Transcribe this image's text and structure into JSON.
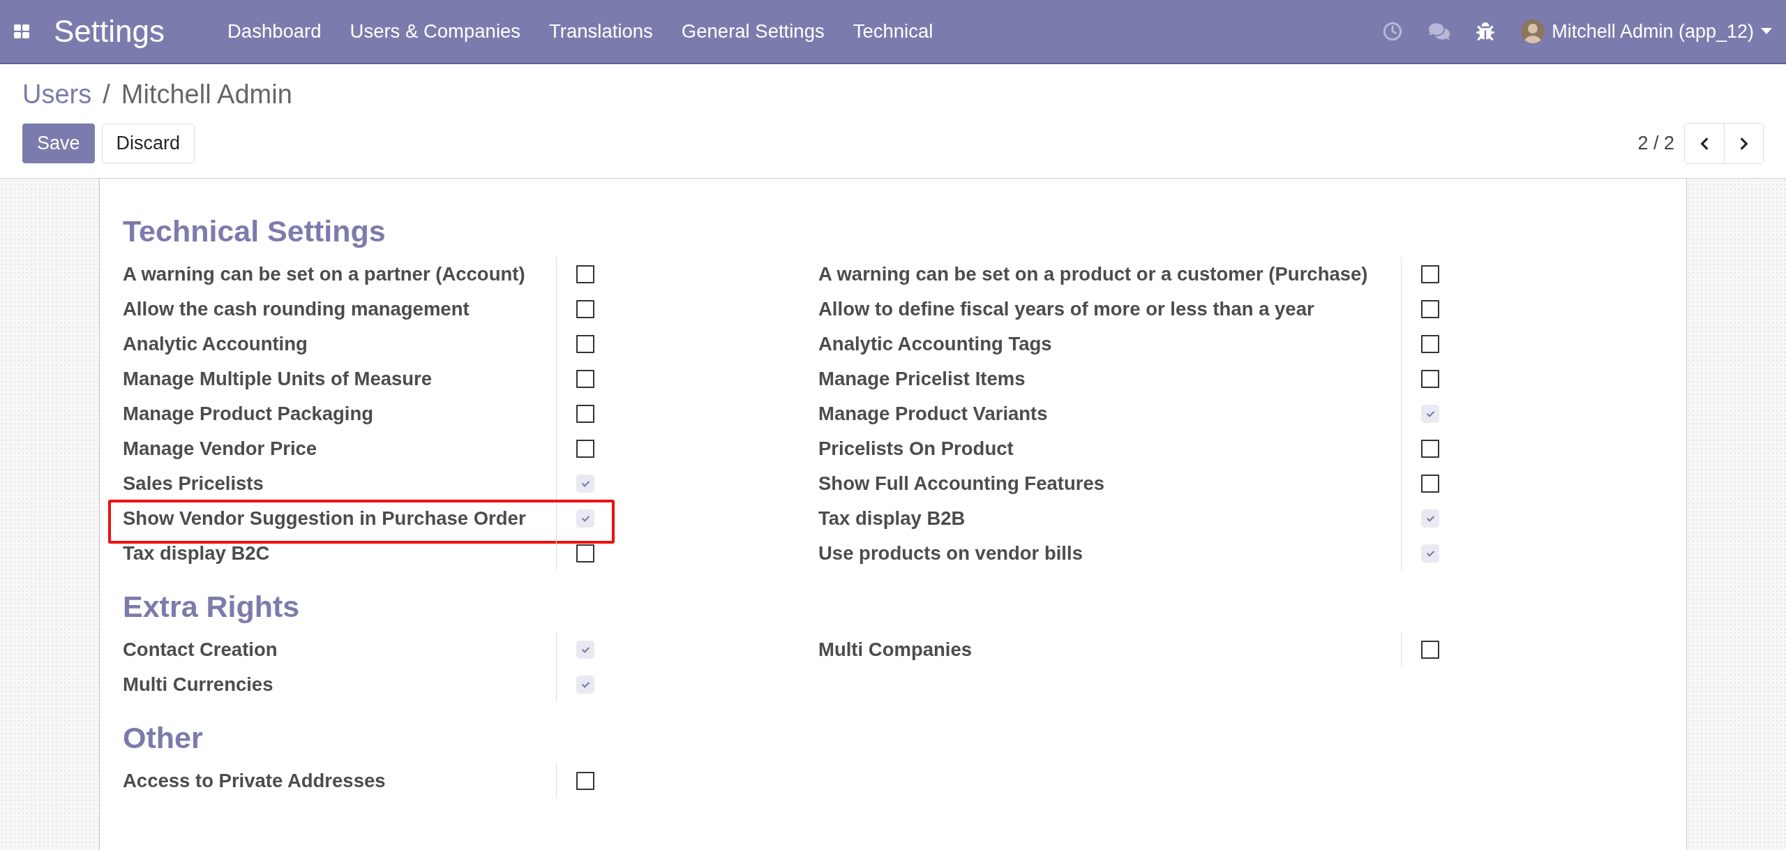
{
  "navbar": {
    "app_title": "Settings",
    "menu": [
      "Dashboard",
      "Users & Companies",
      "Translations",
      "General Settings",
      "Technical"
    ],
    "user": "Mitchell Admin (app_12)"
  },
  "breadcrumb": {
    "parent": "Users",
    "separator": "/",
    "current": "Mitchell Admin"
  },
  "buttons": [
    {
      "label": "Save",
      "kind": "primary"
    },
    {
      "label": "Discard",
      "kind": "secondary"
    }
  ],
  "pager": "2 / 2",
  "sections": [
    {
      "title": "Technical Settings",
      "columns": [
        [
          {
            "label": "A warning can be set on a partner (Account)",
            "checked": false,
            "highlighted": false
          },
          {
            "label": "Allow the cash rounding management",
            "checked": false,
            "highlighted": false
          },
          {
            "label": "Analytic Accounting",
            "checked": false,
            "highlighted": false
          },
          {
            "label": "Manage Multiple Units of Measure",
            "checked": false,
            "highlighted": false
          },
          {
            "label": "Manage Product Packaging",
            "checked": false,
            "highlighted": false
          },
          {
            "label": "Manage Vendor Price",
            "checked": false,
            "highlighted": false
          },
          {
            "label": "Sales Pricelists",
            "checked": true,
            "highlighted": false
          },
          {
            "label": "Show Vendor Suggestion in Purchase Order",
            "checked": true,
            "highlighted": true
          },
          {
            "label": "Tax display B2C",
            "checked": false,
            "highlighted": false
          }
        ],
        [
          {
            "label": "A warning can be set on a product or a customer (Purchase)",
            "checked": false,
            "highlighted": false
          },
          {
            "label": "Allow to define fiscal years of more or less than a year",
            "checked": false,
            "highlighted": false
          },
          {
            "label": "Analytic Accounting Tags",
            "checked": false,
            "highlighted": false
          },
          {
            "label": "Manage Pricelist Items",
            "checked": false,
            "highlighted": false
          },
          {
            "label": "Manage Product Variants",
            "checked": true,
            "highlighted": false
          },
          {
            "label": "Pricelists On Product",
            "checked": false,
            "highlighted": false
          },
          {
            "label": "Show Full Accounting Features",
            "checked": false,
            "highlighted": false
          },
          {
            "label": "Tax display B2B",
            "checked": true,
            "highlighted": false
          },
          {
            "label": "Use products on vendor bills",
            "checked": true,
            "highlighted": false
          }
        ]
      ]
    },
    {
      "title": "Extra Rights",
      "columns": [
        [
          {
            "label": "Contact Creation",
            "checked": true,
            "highlighted": false
          },
          {
            "label": "Multi Currencies",
            "checked": true,
            "highlighted": false
          }
        ],
        [
          {
            "label": "Multi Companies",
            "checked": false,
            "highlighted": false
          }
        ]
      ]
    },
    {
      "title": "Other",
      "columns": [
        [
          {
            "label": "Access to Private Addresses",
            "checked": false,
            "highlighted": false
          }
        ]
      ]
    }
  ]
}
